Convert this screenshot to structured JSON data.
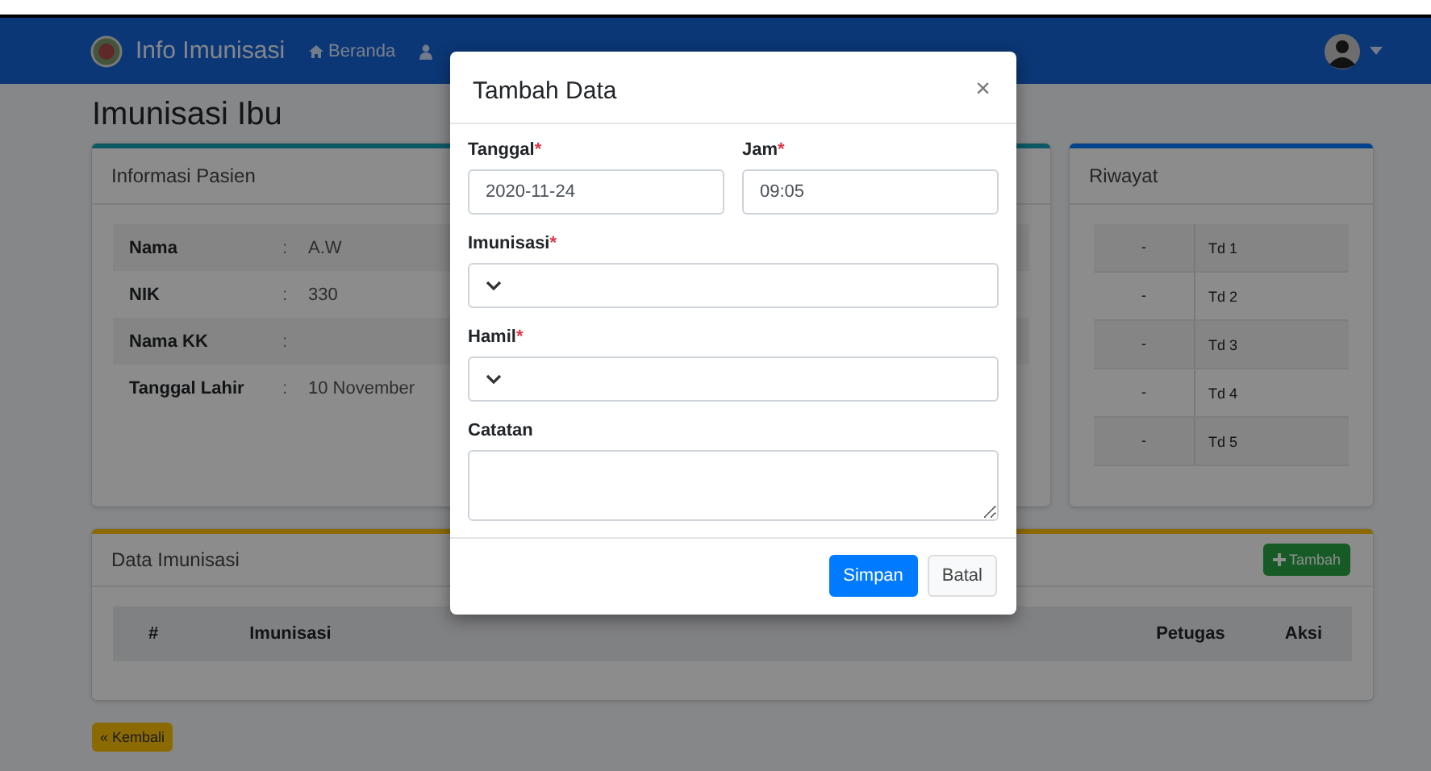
{
  "navbar": {
    "brand": "Info Imunisasi",
    "items": [
      {
        "label": "Beranda"
      }
    ]
  },
  "page_title": "Imunisasi Ibu",
  "patient_card": {
    "title": "Informasi Pasien",
    "rows": [
      {
        "label": "Nama",
        "separator": ":",
        "value": "A.W"
      },
      {
        "label": "NIK",
        "separator": ":",
        "value": "330"
      },
      {
        "label": "Nama KK",
        "separator": ":",
        "value": ""
      },
      {
        "label": "Tanggal Lahir",
        "separator": ":",
        "value": "10 November"
      }
    ]
  },
  "history_card": {
    "title": "Riwayat",
    "rows": [
      {
        "column_1": "-",
        "column_2": "Td 1"
      },
      {
        "column_1": "-",
        "column_2": "Td 2"
      },
      {
        "column_1": "-",
        "column_2": "Td 3"
      },
      {
        "column_1": "-",
        "column_2": "Td 4"
      },
      {
        "column_1": "-",
        "column_2": "Td 5"
      }
    ]
  },
  "data_card": {
    "title": "Data Imunisasi",
    "add_button": "Tambah",
    "columns": [
      "#",
      "Imunisasi",
      "Petugas",
      "Aksi"
    ]
  },
  "back_button": "« Kembali",
  "modal": {
    "title": "Tambah Data",
    "close": "×",
    "fields": [
      {
        "label": "Tanggal",
        "required": true,
        "kind": "text",
        "value": "2020-11-24"
      },
      {
        "label": "Jam",
        "required": true,
        "kind": "text",
        "value": "09:05"
      },
      {
        "label": "Imunisasi",
        "required": true,
        "kind": "select"
      },
      {
        "label": "Hamil",
        "required": true,
        "kind": "select"
      },
      {
        "label": "Catatan",
        "required": false,
        "kind": "textarea"
      }
    ],
    "required_mark": "*",
    "buttons": [
      {
        "label": "Simpan",
        "kind": "primary"
      },
      {
        "label": "Batal",
        "kind": "secondary"
      }
    ]
  }
}
